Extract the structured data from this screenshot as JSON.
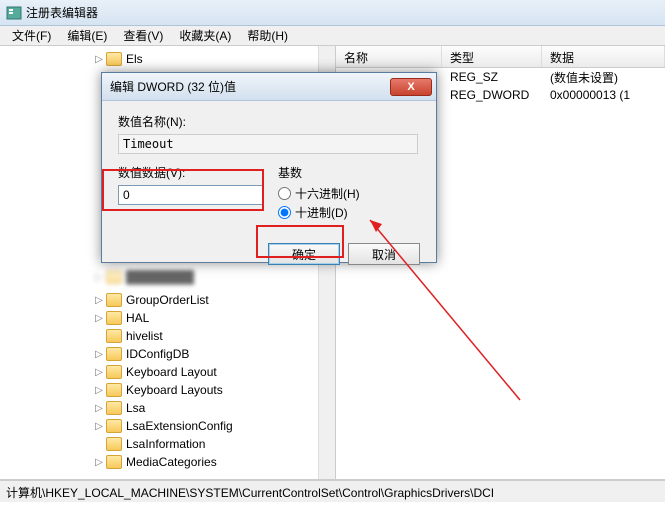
{
  "window": {
    "title": "注册表编辑器"
  },
  "menu": {
    "file": "文件(F)",
    "edit": "编辑(E)",
    "view": "查看(V)",
    "favorites": "收藏夹(A)",
    "help": "帮助(H)"
  },
  "tree": {
    "top_item": "Els",
    "items": [
      "GroupOrderList",
      "HAL",
      "hivelist",
      "IDConfigDB",
      "Keyboard Layout",
      "Keyboard Layouts",
      "Lsa",
      "LsaExtensionConfig",
      "LsaInformation",
      "MediaCategories"
    ]
  },
  "list": {
    "headers": {
      "name": "名称",
      "type": "类型",
      "data": "数据"
    },
    "rows": [
      {
        "name": "",
        "type": "REG_SZ",
        "data": "(数值未设置)"
      },
      {
        "name": "",
        "type": "REG_DWORD",
        "data": "0x00000013 (1"
      }
    ]
  },
  "dialog": {
    "title": "编辑 DWORD (32 位)值",
    "name_label": "数值名称(N):",
    "name_value": "Timeout",
    "data_label": "数值数据(V):",
    "data_value": "0",
    "base_label": "基数",
    "hex_label": "十六进制(H)",
    "dec_label": "十进制(D)",
    "ok": "确定",
    "cancel": "取消",
    "close_x": "X"
  },
  "statusbar": {
    "path": "计算机\\HKEY_LOCAL_MACHINE\\SYSTEM\\CurrentControlSet\\Control\\GraphicsDrivers\\DCI"
  }
}
